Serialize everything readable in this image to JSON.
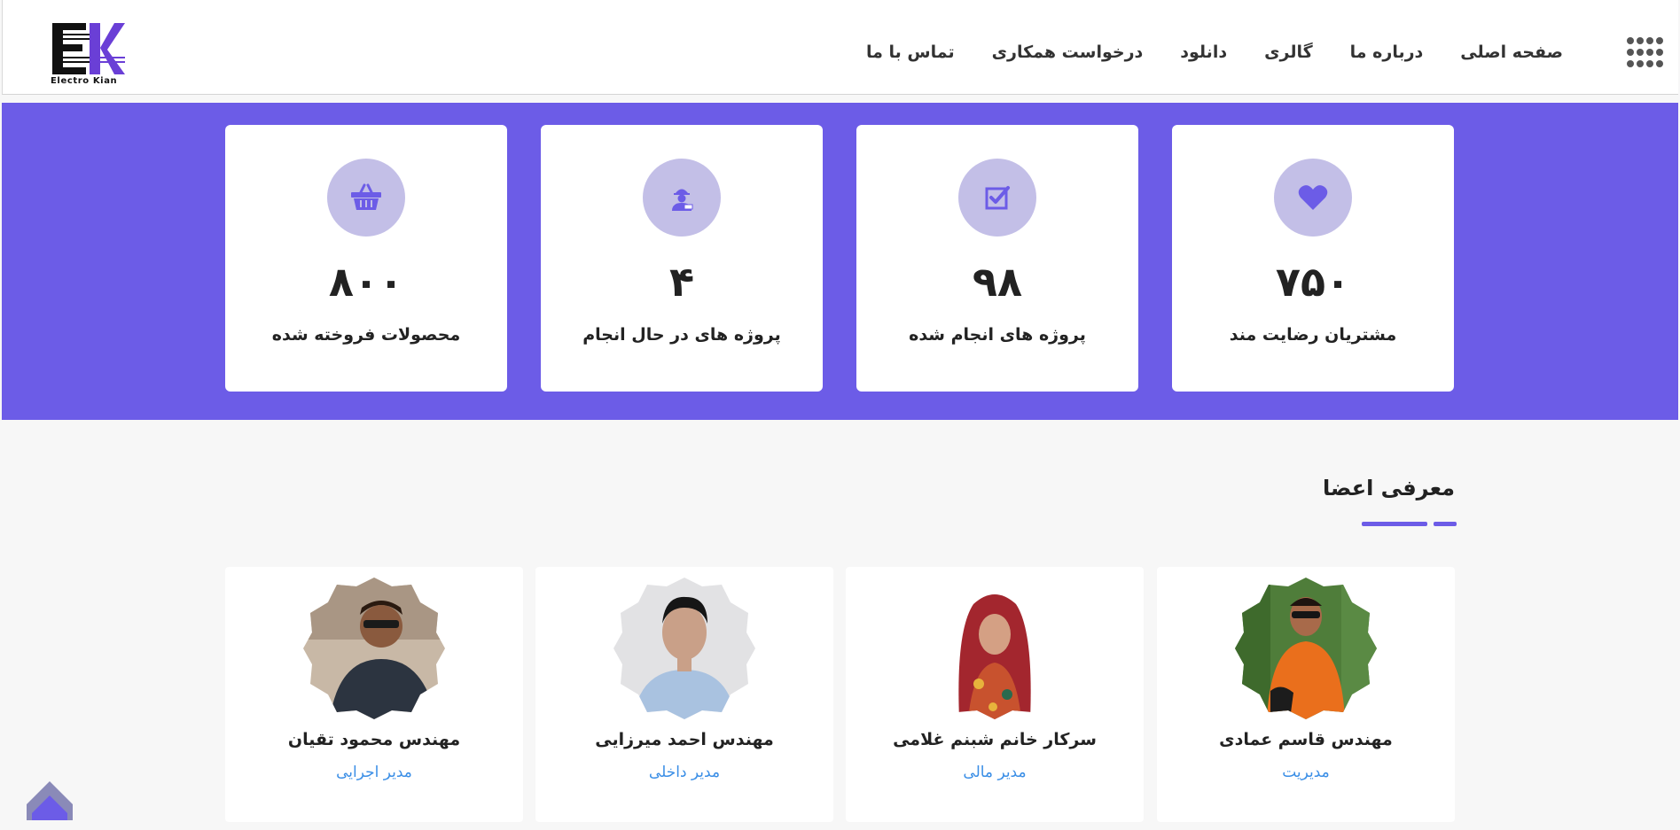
{
  "header": {
    "logo_text": "Electro Kian",
    "logo_letters": "EK",
    "nav": [
      {
        "label": "صفحه اصلی"
      },
      {
        "label": "درباره ما"
      },
      {
        "label": "گالری"
      },
      {
        "label": "دانلود"
      },
      {
        "label": "درخواست همکاری"
      },
      {
        "label": "تماس با ما"
      }
    ],
    "menu_icon": "grid-menu-icon"
  },
  "stats": [
    {
      "number": "۸۰۰",
      "label": "محصولات فروخته شده",
      "icon": "basket-icon"
    },
    {
      "number": "۴",
      "label": "پروژه های در حال انجام",
      "icon": "worker-icon"
    },
    {
      "number": "۹۸",
      "label": "پروژه های انجام شده",
      "icon": "checkbox-icon"
    },
    {
      "number": "۷۵۰",
      "label": "مشتریان رضایت مند",
      "icon": "heart-icon"
    }
  ],
  "team": {
    "title": "معرفی اعضا",
    "members": [
      {
        "name": "مهندس محمود تقیان",
        "role": "مدیر اجرایی"
      },
      {
        "name": "مهندس احمد میرزایی",
        "role": "مدیر داخلی"
      },
      {
        "name": "سرکار خانم شبنم غلامی",
        "role": "مدیر مالی"
      },
      {
        "name": "مهندس قاسم عمادی",
        "role": "مدیریت"
      }
    ]
  },
  "colors": {
    "accent": "#6c5ce7",
    "icon_circle": "#c3bfe7",
    "role_text": "#3a8ee6"
  }
}
